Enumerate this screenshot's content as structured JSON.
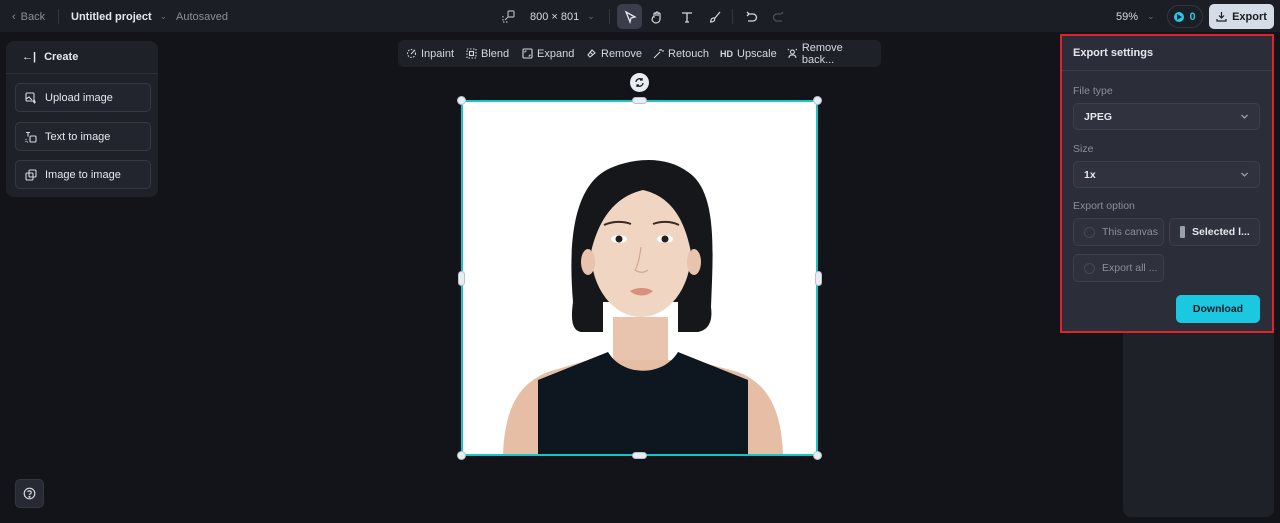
{
  "topbar": {
    "back_label": "Back",
    "project_title": "Untitled project",
    "autosave_status": "Autosaved",
    "canvas_dimensions": "800 × 801",
    "tools": [
      {
        "name": "select-tool",
        "icon": "pointer-icon",
        "active": true
      },
      {
        "name": "hand-tool",
        "icon": "hand-icon",
        "active": false
      },
      {
        "name": "text-tool",
        "icon": "text-icon",
        "active": false
      },
      {
        "name": "brush-tool",
        "icon": "brush-icon",
        "active": false
      }
    ],
    "undo_icon": "undo-icon",
    "redo_icon": "redo-icon",
    "zoom_level": "59%",
    "credits": "0",
    "export_label": "Export"
  },
  "edit_toolbar": {
    "items": [
      {
        "label": "Inpaint",
        "icon": "inpaint-icon"
      },
      {
        "label": "Blend",
        "icon": "blend-icon"
      },
      {
        "label": "Expand",
        "icon": "expand-icon"
      },
      {
        "label": "Remove",
        "icon": "eraser-icon"
      },
      {
        "label": "Retouch",
        "icon": "wand-icon"
      },
      {
        "label": "Upscale",
        "icon": "hd-icon",
        "prefix": "HD"
      },
      {
        "label": "Remove back...",
        "icon": "remove-bg-icon"
      }
    ]
  },
  "left_panel": {
    "title": "Create",
    "buttons": [
      {
        "label": "Upload image",
        "icon": "upload-image-icon"
      },
      {
        "label": "Text to image",
        "icon": "text-to-image-icon"
      },
      {
        "label": "Image to image",
        "icon": "image-to-image-icon"
      }
    ]
  },
  "canvas": {
    "image_description": "Portrait of a young woman with short black bob hair and a dark sleeveless top on white background"
  },
  "export_settings": {
    "title": "Export settings",
    "file_type_label": "File type",
    "file_type_value": "JPEG",
    "size_label": "Size",
    "size_value": "1x",
    "export_option_label": "Export option",
    "options": [
      {
        "label": "This canvas",
        "selected": false
      },
      {
        "label": "Selected l...",
        "selected": true
      },
      {
        "label": "Export all ...",
        "selected": false
      }
    ],
    "download_label": "Download"
  },
  "colors": {
    "accent": "#1cc8e0",
    "selection": "#19c4c9",
    "highlight_border": "#e0222b",
    "background": "#131419",
    "panel": "#1f2129"
  }
}
